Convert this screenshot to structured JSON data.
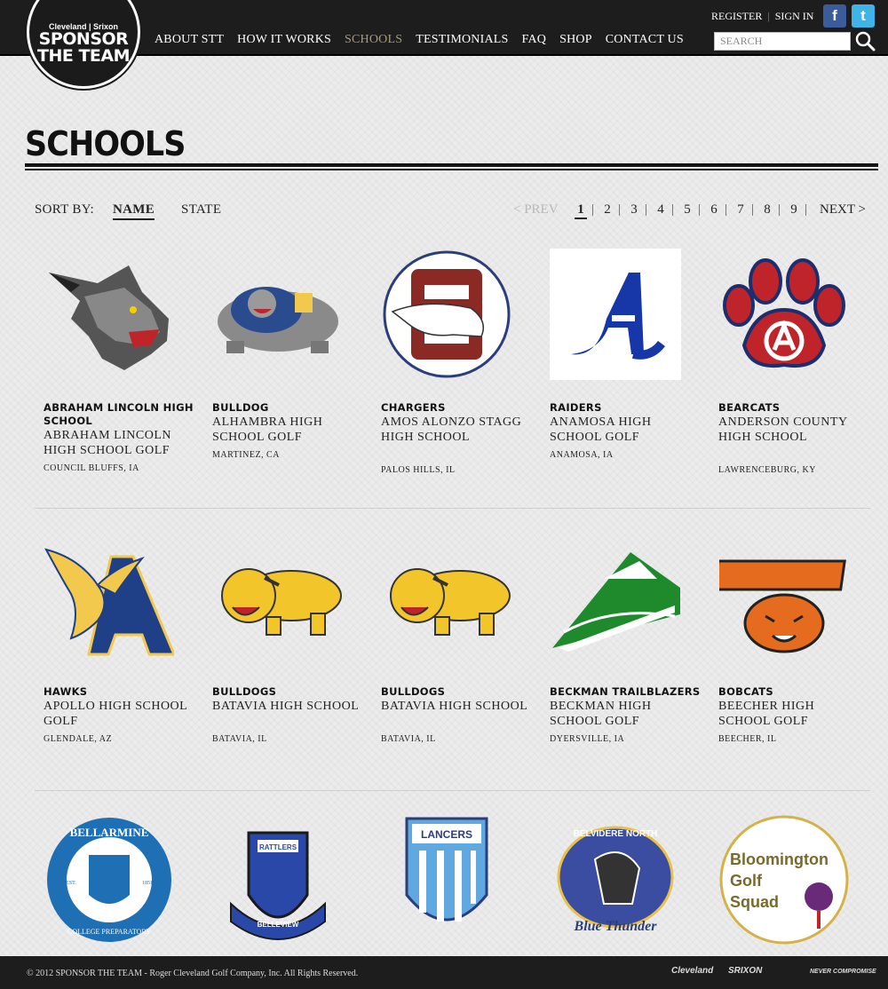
{
  "header": {
    "logo": {
      "brands": "Cleveland | Srixon",
      "line1": "SPONSOR",
      "line2": "THE TEAM"
    },
    "nav": [
      {
        "label": "ABOUT STT",
        "active": false
      },
      {
        "label": "HOW IT WORKS",
        "active": false
      },
      {
        "label": "SCHOOLS",
        "active": true
      },
      {
        "label": "TESTIMONIALS",
        "active": false
      },
      {
        "label": "FAQ",
        "active": false
      },
      {
        "label": "SHOP",
        "active": false
      },
      {
        "label": "CONTACT US",
        "active": false
      }
    ],
    "register": "REGISTER",
    "sign_in": "SIGN IN",
    "search_placeholder": "SEARCH",
    "facebook_glyph": "f",
    "twitter_glyph": "t"
  },
  "page": {
    "title": "SCHOOLS"
  },
  "sort": {
    "label": "SORT BY:",
    "options": [
      "NAME",
      "STATE"
    ],
    "selected": "NAME"
  },
  "pagination": {
    "prev": "< PREV",
    "pages": [
      "1",
      "2",
      "3",
      "4",
      "5",
      "6",
      "7",
      "8",
      "9"
    ],
    "current": "1",
    "next": "NEXT >"
  },
  "schools": [
    {
      "mascot": "ABRAHAM LINCOLN HIGH SCHOOL",
      "school": "ABRAHAM LINCOLN HIGH SCHOOL GOLF",
      "location": "COUNCIL BLUFFS, IA",
      "logo_icon": "lynx-icon"
    },
    {
      "mascot": "BULLDOG",
      "school": "ALHAMBRA HIGH SCHOOL GOLF",
      "location": "MARTINEZ, CA",
      "logo_icon": "bulldog-icon"
    },
    {
      "mascot": "CHARGERS",
      "school": "AMOS ALONZO STAGG HIGH SCHOOL",
      "location": "PALOS HILLS, IL",
      "logo_icon": "mustang-s-icon"
    },
    {
      "mascot": "RAIDERS",
      "school": "ANAMOSA HIGH SCHOOL GOLF",
      "location": "ANAMOSA, IA",
      "logo_icon": "letter-a-icon"
    },
    {
      "mascot": "BEARCATS",
      "school": "ANDERSON COUNTY HIGH SCHOOL",
      "location": "LAWRENCEBURG, KY",
      "logo_icon": "paw-icon"
    },
    {
      "mascot": "HAWKS",
      "school": "APOLLO HIGH SCHOOL GOLF",
      "location": "GLENDALE, AZ",
      "logo_icon": "hawk-a-icon"
    },
    {
      "mascot": "BULLDOGS",
      "school": "BATAVIA HIGH SCHOOL",
      "location": "BATAVIA, IL",
      "logo_icon": "yellow-bulldog-icon"
    },
    {
      "mascot": "BULLDOGS",
      "school": "BATAVIA HIGH SCHOOL",
      "location": "BATAVIA, IL",
      "logo_icon": "yellow-bulldog-icon"
    },
    {
      "mascot": "BECKMAN TRAILBLAZERS",
      "school": "BECKMAN HIGH SCHOOL GOLF",
      "location": "DYERSVILLE, IA",
      "logo_icon": "blazers-icon"
    },
    {
      "mascot": "BOBCATS",
      "school": "BEECHER HIGH SCHOOL GOLF",
      "location": "BEECHER, IL",
      "logo_icon": "bobcat-icon"
    }
  ],
  "partial_row_logos": [
    {
      "logo_icon": "bellarmine-seal-icon",
      "text_top": "BELLARMINE",
      "text_bottom": "COLLEGE PREPARATORY",
      "est": "EST.",
      "year": "1851"
    },
    {
      "logo_icon": "rattlers-crest-icon",
      "text_top": "RATTLERS",
      "text_bottom": "BELLEVIEW"
    },
    {
      "logo_icon": "lancers-shield-icon",
      "text_top": "LANCERS"
    },
    {
      "logo_icon": "blue-thunder-icon",
      "text_top": "BELVIDERE NORTH",
      "text_bottom": "Blue Thunder"
    },
    {
      "logo_icon": "golf-squad-icon",
      "text_top": "Bloomington",
      "text_mid": "Golf",
      "text_bottom": "Squad"
    }
  ],
  "footer": {
    "copyright": "© 2012 SPONSOR THE TEAM - Roger Cleveland Golf Company, Inc. All Rights Reserved.",
    "brand1": "Cleveland",
    "brand2": "SRIXON",
    "brand3": "NEVER COMPROMISE"
  },
  "colors": {
    "nav_active": "#a89a78",
    "header_bg": "#1d1d1d",
    "facebook": "#3b5c9b",
    "twitter": "#3fb4e8"
  }
}
